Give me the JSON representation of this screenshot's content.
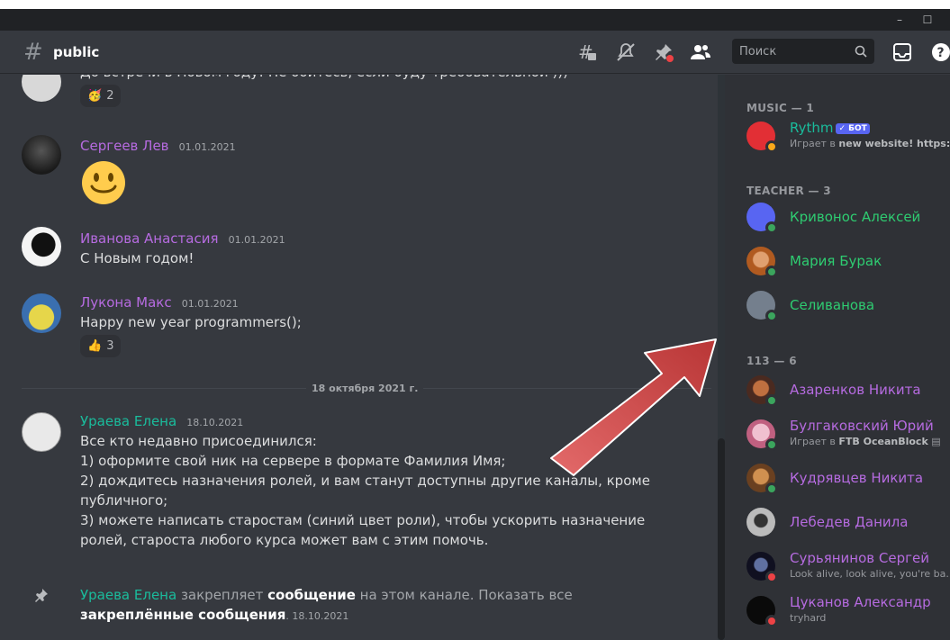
{
  "window": {
    "minimize": "–",
    "maximize": "☐"
  },
  "header": {
    "channel_name": "public",
    "search_placeholder": "Поиск"
  },
  "messages": {
    "m0_partial_text": "До встречи в Новом году! Не бойтесь, если буду требовательной )))",
    "m0_reaction": {
      "emoji": "🥳",
      "count": "2"
    },
    "m1": {
      "author": "Сергеев Лев",
      "timestamp": "01.01.2021",
      "emoji_text": "🙂"
    },
    "m2": {
      "author": "Иванова Анастасия",
      "timestamp": "01.01.2021",
      "text": "С Новым годом!"
    },
    "m3": {
      "author": "Лукона Макс",
      "timestamp": "01.01.2021",
      "text": "Happy new year programmers();",
      "reaction": {
        "emoji": "👍",
        "count": "3"
      }
    },
    "divider": "18 октября 2021 г.",
    "m4": {
      "author": "Ураева Елена",
      "timestamp": "18.10.2021",
      "lines": [
        "Все кто недавно присоединился:",
        "1) оформите свой ник на сервере в формате Фамилия Имя;",
        "2) дождитесь назначения ролей, и вам станут доступны другие каналы, кроме",
        "публичного;",
        "3) можете написать старостам (синий цвет роли), чтобы ускорить назначение",
        "ролей, староста любого курса может вам с этим помочь."
      ]
    },
    "m5": {
      "author": "Ураева Елена",
      "text_a": " закрепляет ",
      "bold_a": "сообщение",
      "text_b": " на этом канале. Показать все",
      "bold_b": "закреплённые сообщения",
      "timestamp": ". 18.10.2021"
    }
  },
  "members": {
    "groups": [
      {
        "label": "MUSIC — 1"
      },
      {
        "label": "TEACHER — 3"
      },
      {
        "label": "113 — 6"
      }
    ],
    "rythm": {
      "name": "Rythm",
      "bot_tag": "✓ БОТ",
      "sub_prefix": "Играет в ",
      "sub_bold": "new website! https:/..."
    },
    "teachers": [
      {
        "name": "Кривонос Алексей"
      },
      {
        "name": "Мария Бурак"
      },
      {
        "name": "Селиванова"
      }
    ],
    "students": [
      {
        "name": "Азаренков Никита",
        "sub": ""
      },
      {
        "name": "Булгаковский Юрий",
        "sub_prefix": "Играет в ",
        "sub_bold": "FTB OceanBlock"
      },
      {
        "name": "Кудрявцев Никита",
        "sub": ""
      },
      {
        "name": "Лебедев Данила",
        "sub": ""
      },
      {
        "name": "Сурьянинов Сергей",
        "sub": "Look alive, look alive, you're ba..."
      },
      {
        "name": "Цуканов Александр",
        "sub": "tryhard"
      }
    ]
  },
  "colors": {
    "teal": "#1abc9c",
    "purple": "#b66be0",
    "green": "#2ecc71",
    "arrow": "#d0494a"
  }
}
